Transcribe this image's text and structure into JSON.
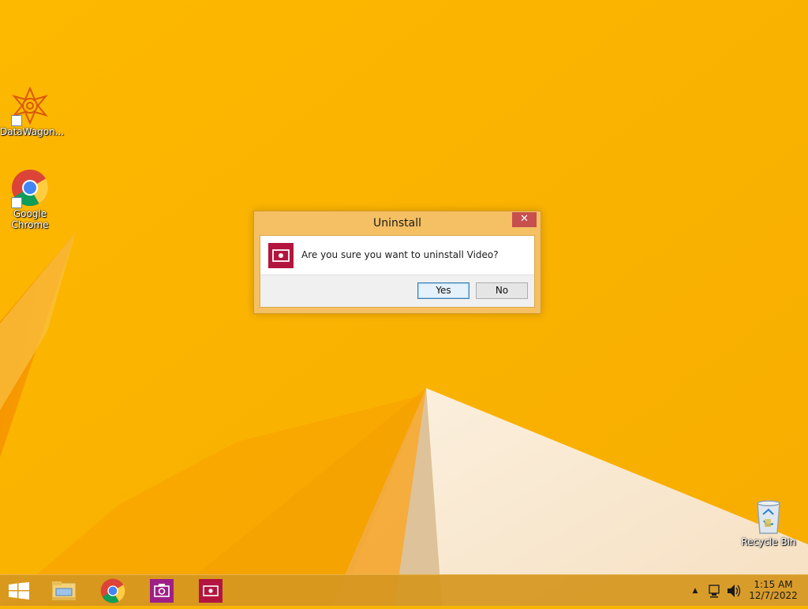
{
  "desktop": {
    "icons": [
      {
        "label": "DataWagon...",
        "icon": "datawagon-icon"
      },
      {
        "label": "Google\nChrome",
        "icon": "chrome-icon"
      },
      {
        "label": "Recycle Bin",
        "icon": "recycle-bin-icon"
      }
    ]
  },
  "dialog": {
    "title": "Uninstall",
    "close_label": "✕",
    "message": "Are you sure you want to uninstall Video?",
    "yes_label": "Yes",
    "no_label": "No",
    "app_icon": "video-app-icon"
  },
  "taskbar": {
    "items": [
      "start-icon",
      "file-explorer-icon",
      "chrome-icon",
      "camera-app-icon",
      "video-app-icon"
    ],
    "tray": {
      "chevron": "▲",
      "time": "1:15 AM",
      "date": "12/7/2022"
    }
  },
  "colors": {
    "wallpaper": "#f9b400",
    "video_app": "#b3153f",
    "camera_app": "#9e1f86",
    "dialog_frame": "#f5c063",
    "close_button": "#c7504f"
  }
}
